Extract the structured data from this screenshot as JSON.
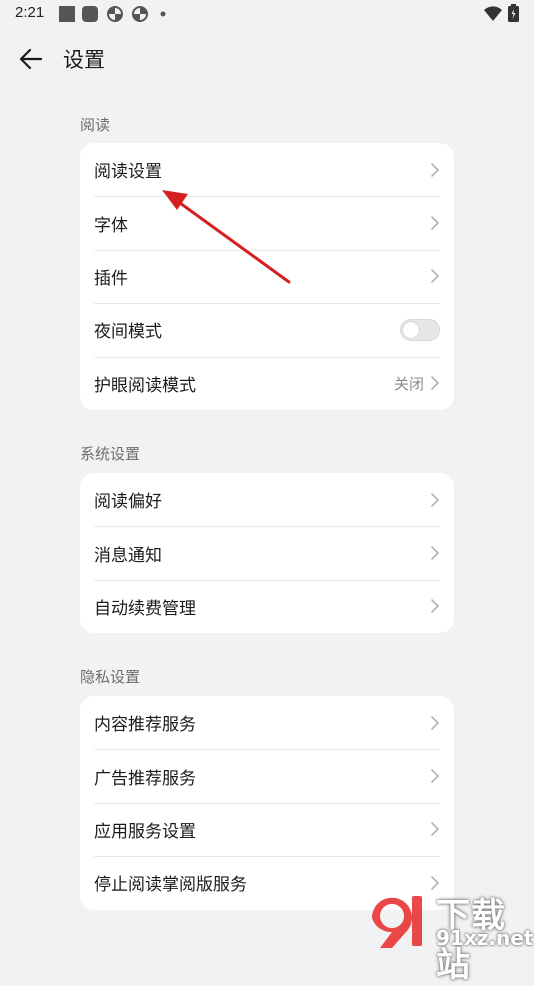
{
  "status": {
    "time": "2:21",
    "icons": [
      "square-icon",
      "rounded-square-icon",
      "pinwheel-icon",
      "pinwheel-icon",
      "dot-icon",
      "wifi-icon",
      "battery-icon"
    ]
  },
  "appbar": {
    "title": "设置",
    "back_icon": "arrow-left-icon"
  },
  "sections": [
    {
      "label": "阅读",
      "items": [
        {
          "label": "阅读设置",
          "control": "chevron"
        },
        {
          "label": "字体",
          "control": "chevron"
        },
        {
          "label": "插件",
          "control": "chevron"
        },
        {
          "label": "夜间模式",
          "control": "toggle",
          "toggle_on": false
        },
        {
          "label": "护眼阅读模式",
          "control": "chevron",
          "value": "关闭"
        }
      ]
    },
    {
      "label": "系统设置",
      "items": [
        {
          "label": "阅读偏好",
          "control": "chevron"
        },
        {
          "label": "消息通知",
          "control": "chevron"
        },
        {
          "label": "自动续费管理",
          "control": "chevron"
        }
      ]
    },
    {
      "label": "隐私设置",
      "items": [
        {
          "label": "内容推荐服务",
          "control": "chevron"
        },
        {
          "label": "广告推荐服务",
          "control": "chevron"
        },
        {
          "label": "应用服务设置",
          "control": "chevron"
        },
        {
          "label": "停止阅读掌阅版服务",
          "control": "chevron"
        }
      ]
    }
  ],
  "annotation": {
    "arrow_color": "#e02020"
  },
  "watermark": {
    "text_top": "下载站",
    "text_bottom": "91xz.net",
    "logo_color": "#e83838"
  },
  "colors": {
    "background": "#f1f2f4",
    "card": "#ffffff",
    "text": "#1b1b1b",
    "muted": "#6d6d6d"
  }
}
